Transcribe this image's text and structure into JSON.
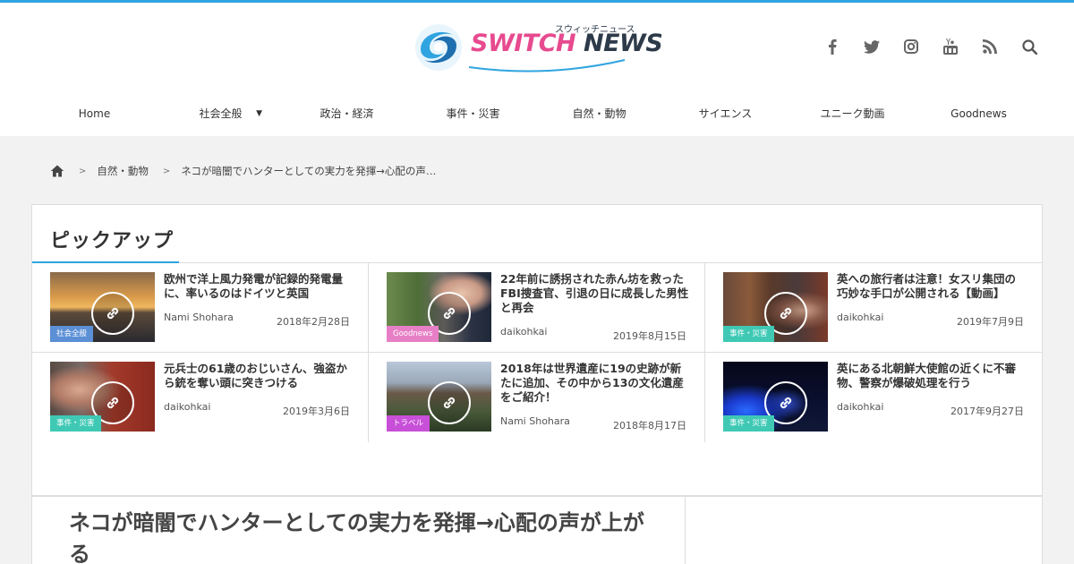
{
  "colors": {
    "accent": "#2fa4e0",
    "brand_pink": "#e74a8f",
    "brand_dark": "#2d3a4a"
  },
  "logo": {
    "word1": "SWITCH",
    "word2": "NEWS",
    "kana": "スウィッチニュース"
  },
  "social_icons": [
    "facebook-icon",
    "twitter-icon",
    "instagram-icon",
    "youtube-icon",
    "rss-icon",
    "search-icon"
  ],
  "nav": {
    "items": [
      {
        "label": "Home"
      },
      {
        "label": "社会全般",
        "dropdown_marker": "▼"
      },
      {
        "label": "政治・経済"
      },
      {
        "label": "事件・災害"
      },
      {
        "label": "自然・動物"
      },
      {
        "label": "サイエンス"
      },
      {
        "label": "ユニーク動画"
      },
      {
        "label": "Goodnews"
      }
    ]
  },
  "breadcrumb": {
    "sep": ">",
    "category": "自然・動物",
    "current": "ネコが暗闇でハンターとしての実力を発揮→心配の声…"
  },
  "pickup": {
    "heading": "ピックアップ",
    "items": [
      {
        "title": "欧州で洋上風力発電が記録的発電量に、率いるのはドイツと英国",
        "author": "Nami Shohara",
        "date": "2018年2月28日",
        "badge": "社会全般",
        "badge_color": "#5b8fd6"
      },
      {
        "title": "22年前に誘拐された赤ん坊を救ったFBI捜査官、引退の日に成長した男性と再会",
        "author": "daikohkai",
        "date": "2019年8月15日",
        "badge": "Goodnews",
        "badge_color": "#e77fc6"
      },
      {
        "title": "英への旅行者は注意！女スリ集団の巧妙な手口が公開される【動画】",
        "author": "daikohkai",
        "date": "2019年7月9日",
        "badge": "事件・災害",
        "badge_color": "#3fc9b5"
      },
      {
        "title": "元兵士の61歳のおじいさん、強盗から銃を奪い頭に突きつける",
        "author": "daikohkai",
        "date": "2019年3月6日",
        "badge": "事件・災害",
        "badge_color": "#3fc9b5"
      },
      {
        "title": "2018年は世界遺産に19の史跡が新たに追加、その中から13の文化遺産をご紹介！",
        "author": "Nami Shohara",
        "date": "2018年8月17日",
        "badge": "トラベル",
        "badge_color": "#c84fd8"
      },
      {
        "title": "英にある北朝鮮大使館の近くに不審物、警察が爆破処理を行う",
        "author": "daikohkai",
        "date": "2017年9月27日",
        "badge": "事件・災害",
        "badge_color": "#3fc9b5"
      }
    ]
  },
  "article": {
    "title": "ネコが暗闇でハンターとしての実力を発揮→心配の声が上がる"
  }
}
